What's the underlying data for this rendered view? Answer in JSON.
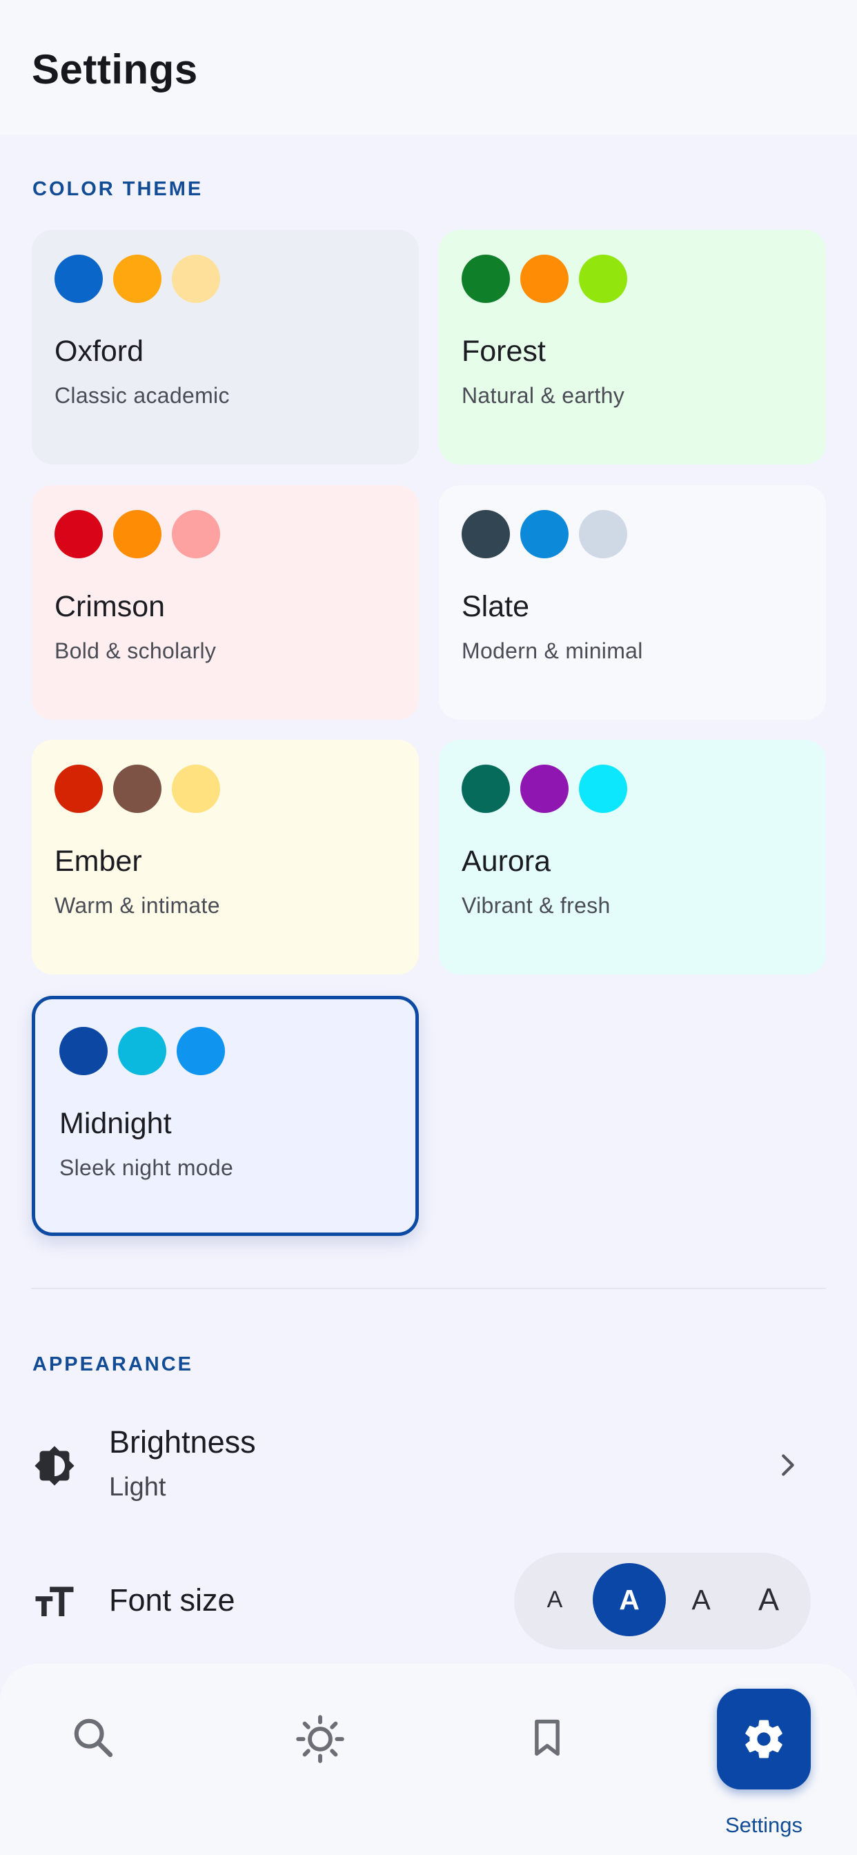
{
  "header": {
    "title": "Settings"
  },
  "color_theme": {
    "section_label": "COLOR THEME",
    "themes": [
      {
        "name": "Oxford",
        "description": "Classic academic",
        "swatches": [
          "#0b66c9",
          "#ffa70f",
          "#ffe09a"
        ],
        "background": "#eceef5",
        "selected": false
      },
      {
        "name": "Forest",
        "description": "Natural & earthy",
        "swatches": [
          "#0f7f29",
          "#ff8c05",
          "#92e60e"
        ],
        "background": "#e6fde9",
        "selected": false
      },
      {
        "name": "Crimson",
        "description": "Bold & scholarly",
        "swatches": [
          "#d90418",
          "#ff8c05",
          "#fea1a1"
        ],
        "background": "#ffeeef",
        "selected": false
      },
      {
        "name": "Slate",
        "description": "Modern & minimal",
        "swatches": [
          "#324552",
          "#0c8ad9",
          "#cfd8e5"
        ],
        "background": "#f8f9fd",
        "selected": false
      },
      {
        "name": "Ember",
        "description": "Warm & intimate",
        "swatches": [
          "#d42404",
          "#7c5345",
          "#ffe17f"
        ],
        "background": "#fffbe9",
        "selected": false
      },
      {
        "name": "Aurora",
        "description": "Vibrant & fresh",
        "swatches": [
          "#076b5b",
          "#8f16b0",
          "#0de7fd"
        ],
        "background": "#e4fdfb",
        "selected": false
      },
      {
        "name": "Midnight",
        "description": "Sleek night mode",
        "swatches": [
          "#0c47a3",
          "#0bb8de",
          "#0f94ef"
        ],
        "background": "#eef1ff",
        "selected": true
      }
    ]
  },
  "appearance": {
    "section_label": "APPEARANCE",
    "brightness": {
      "title": "Brightness",
      "value": "Light",
      "icon": "contrast-icon"
    },
    "font_size": {
      "title": "Font size",
      "icon": "text-size-icon",
      "options": [
        "A",
        "A",
        "A",
        "A"
      ],
      "selected_index": 1
    }
  },
  "bottom_nav": {
    "items": [
      {
        "name": "search",
        "icon": "search-icon"
      },
      {
        "name": "brightness",
        "icon": "sun-icon"
      },
      {
        "name": "bookmarks",
        "icon": "bookmark-icon"
      },
      {
        "name": "settings",
        "icon": "gear-icon",
        "label": "Settings",
        "active": true
      }
    ]
  },
  "colors": {
    "accent": "#0a47a6",
    "section_label": "#124c95",
    "page_background": "#f2f3fd"
  }
}
